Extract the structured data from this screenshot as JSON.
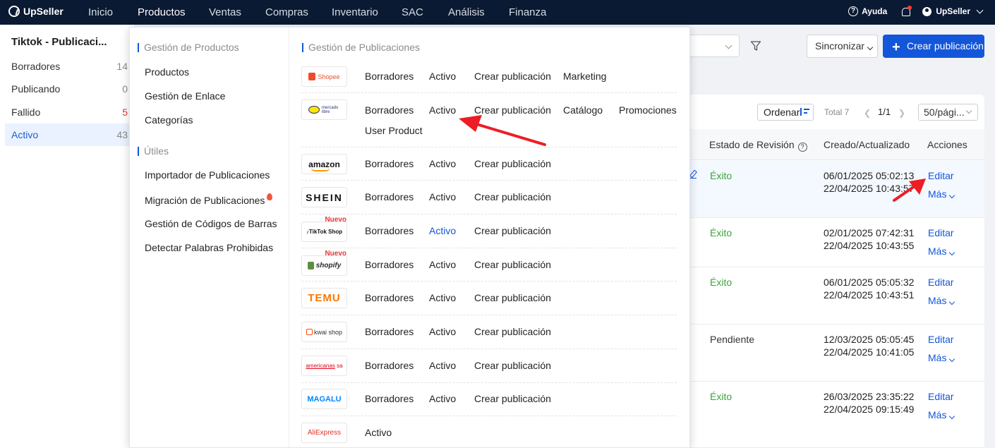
{
  "topbar": {
    "brand": "UpSeller",
    "nav": [
      "Inicio",
      "Productos",
      "Ventas",
      "Compras",
      "Inventario",
      "SAC",
      "Análisis",
      "Finanza"
    ],
    "help": "Ayuda",
    "user": "UpSeller"
  },
  "sidebar": {
    "title": "Tiktok - Publicaci...",
    "items": [
      {
        "label": "Borradores",
        "count": "14"
      },
      {
        "label": "Publicando",
        "count": "0"
      },
      {
        "label": "Fallido",
        "count": "5"
      },
      {
        "label": "Activo",
        "count": "43"
      }
    ]
  },
  "toolbar": {
    "sync": "Sincronizar",
    "create": "Crear publicación"
  },
  "table": {
    "order": "Ordenar",
    "total": "Total 7",
    "page": "1/1",
    "page_size": "50/pági...",
    "headers": {
      "review": "Estado de Revisión",
      "dates": "Creado/Actualizado",
      "actions": "Acciones"
    },
    "rows": [
      {
        "status": "Éxito",
        "created": "06/01/2025 05:02:13",
        "updated": "22/04/2025 10:43:57",
        "edit": "Editar",
        "more": "Más"
      },
      {
        "status": "Éxito",
        "created": "02/01/2025 07:42:31",
        "updated": "22/04/2025 10:43:55",
        "edit": "Editar",
        "more": "Más"
      },
      {
        "status": "Éxito",
        "created": "06/01/2025 05:05:32",
        "updated": "22/04/2025 10:43:51",
        "edit": "Editar",
        "more": "Más"
      },
      {
        "status": "Pendiente",
        "created": "12/03/2025 05:05:45",
        "updated": "22/04/2025 10:41:05",
        "edit": "Editar",
        "more": "Más"
      },
      {
        "status": "Éxito",
        "created": "26/03/2025 23:35:22",
        "updated": "22/04/2025 09:15:49",
        "edit": "Editar",
        "more": "Más"
      }
    ]
  },
  "dropdown": {
    "left": {
      "section1": "Gestión de Productos",
      "items1": [
        "Productos",
        "Gestión de Enlace",
        "Categorías"
      ],
      "section2": "Útiles",
      "items2": [
        "Importador de Publicaciones",
        "Migración de Publicaciones",
        "Gestión de Códigos de Barras",
        "Detectar Palabras Prohibidas"
      ]
    },
    "right": {
      "section": "Gestión de Publicaciones",
      "badge": "Nuevo",
      "platforms": [
        {
          "logo": "Shopee",
          "links": [
            "Borradores",
            "Activo",
            "Crear publicación",
            "Marketing"
          ]
        },
        {
          "logo": "mercado libre",
          "links": [
            "Borradores",
            "Activo",
            "Crear publicación",
            "Catálogo",
            "Promociones",
            "User Product"
          ]
        },
        {
          "logo": "amazon",
          "links": [
            "Borradores",
            "Activo",
            "Crear publicación"
          ]
        },
        {
          "logo": "SHEIN",
          "links": [
            "Borradores",
            "Activo",
            "Crear publicación"
          ]
        },
        {
          "logo": "TikTok Shop",
          "links": [
            "Borradores",
            "Activo",
            "Crear publicación"
          ]
        },
        {
          "logo": "shopify",
          "links": [
            "Borradores",
            "Activo",
            "Crear publicación"
          ]
        },
        {
          "logo": "TEMU",
          "links": [
            "Borradores",
            "Activo",
            "Crear publicación"
          ]
        },
        {
          "logo": "kwai shop",
          "links": [
            "Borradores",
            "Activo",
            "Crear publicación"
          ]
        },
        {
          "logo": "americanas",
          "logo_suffix": "sa",
          "links": [
            "Borradores",
            "Activo",
            "Crear publicación"
          ]
        },
        {
          "logo": "MAGALU",
          "links": [
            "Borradores",
            "Activo",
            "Crear publicación"
          ]
        },
        {
          "logo": "AliExpress",
          "links": [
            "Activo"
          ]
        }
      ]
    }
  },
  "colors": {
    "topbar": "#0b1a33",
    "accent": "#1356d9",
    "success": "#3aa53a",
    "danger": "#e53935",
    "annotation_arrow": "#ee1c25"
  }
}
